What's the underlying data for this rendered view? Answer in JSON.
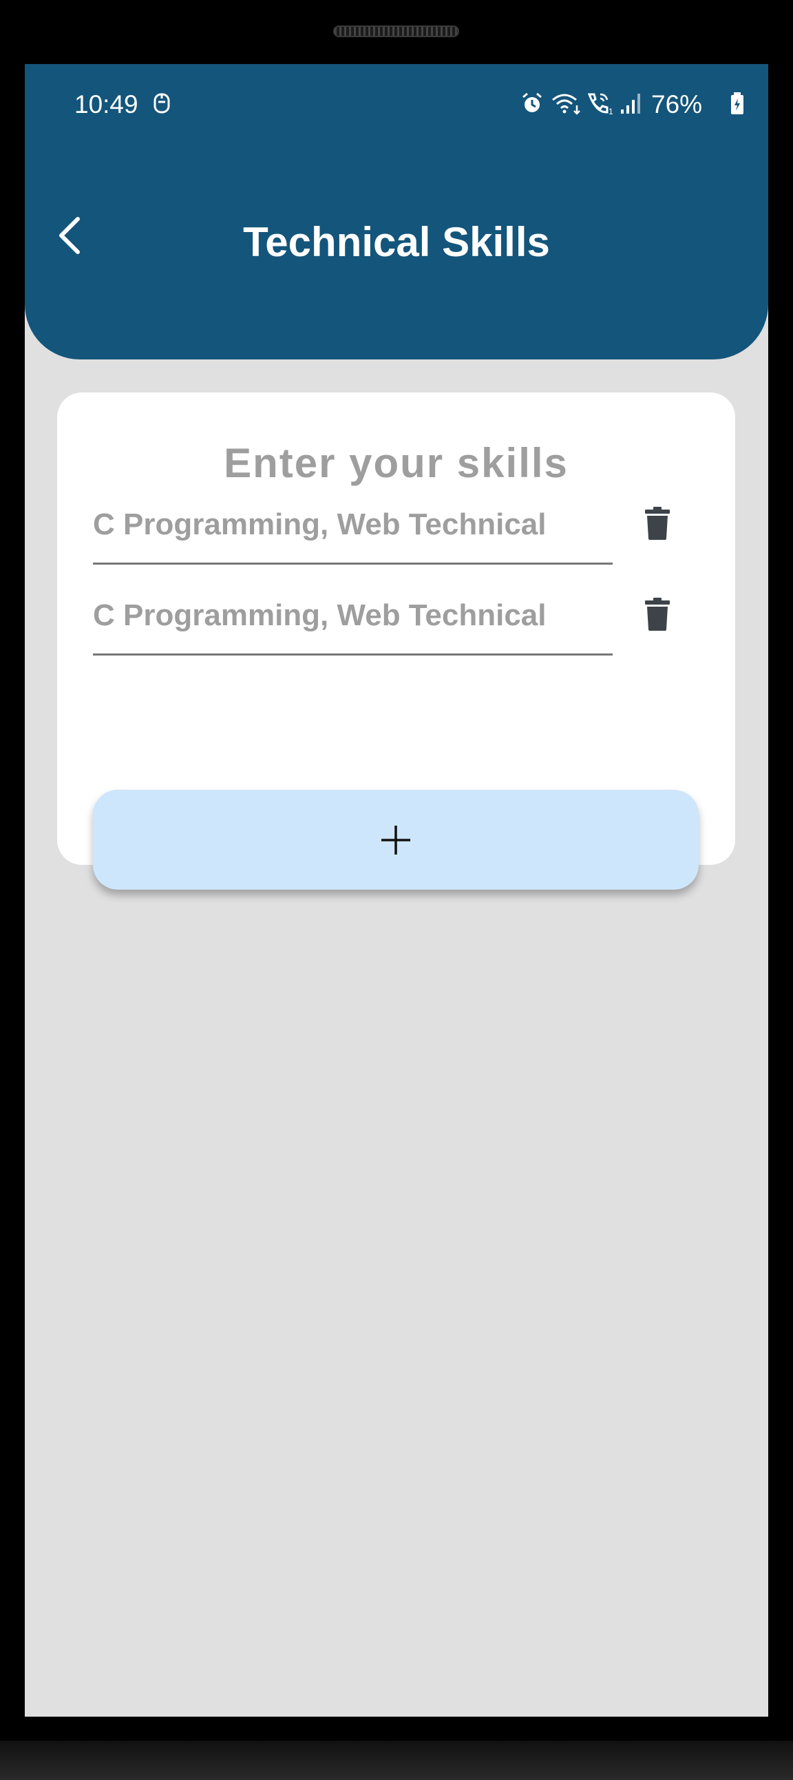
{
  "status_bar": {
    "time": "10:49",
    "battery": "76%",
    "icons": [
      "face-icon",
      "alarm-icon",
      "wifi-icon",
      "call-icon",
      "signal-icon",
      "battery-icon"
    ]
  },
  "header": {
    "title": "Technical Skills",
    "back_icon": "chevron-left-icon",
    "background": "#14557b"
  },
  "card": {
    "heading": "Enter your skills",
    "skills": [
      {
        "value": "",
        "placeholder": "C Programming, Web Technical",
        "delete_icon": "trash-icon"
      },
      {
        "value": "",
        "placeholder": "C Programming, Web Technical",
        "delete_icon": "trash-icon"
      }
    ],
    "add_button": {
      "icon": "plus-icon",
      "background": "#cde6fc"
    }
  },
  "colors": {
    "screen_background": "#e0e0e0",
    "card_background": "#ffffff",
    "muted_text": "#9e9e9e"
  }
}
